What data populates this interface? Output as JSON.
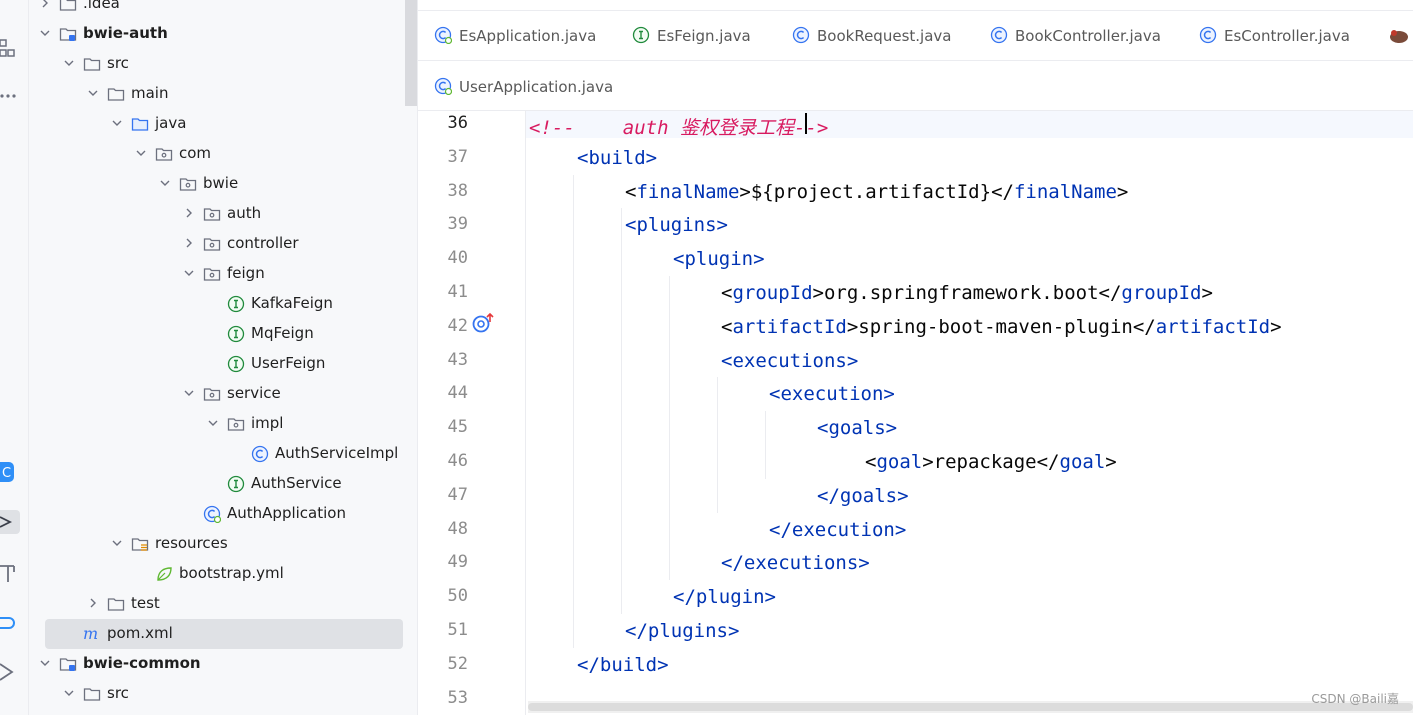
{
  "tree": {
    "rows": [
      {
        "label": ".idea",
        "icon": "folder-icon",
        "bold": false
      },
      {
        "label": "bwie-auth",
        "icon": "module-folder-icon",
        "bold": true
      },
      {
        "label": "src",
        "icon": "folder-icon",
        "bold": false
      },
      {
        "label": "main",
        "icon": "folder-icon",
        "bold": false
      },
      {
        "label": "java",
        "icon": "source-folder-icon",
        "bold": false
      },
      {
        "label": "com",
        "icon": "package-icon",
        "bold": false
      },
      {
        "label": "bwie",
        "icon": "package-icon",
        "bold": false
      },
      {
        "label": "auth",
        "icon": "package-icon",
        "bold": false
      },
      {
        "label": "controller",
        "icon": "package-icon",
        "bold": false
      },
      {
        "label": "feign",
        "icon": "package-icon",
        "bold": false
      },
      {
        "label": "KafkaFeign",
        "icon": "interface-icon",
        "bold": false
      },
      {
        "label": "MqFeign",
        "icon": "interface-icon",
        "bold": false
      },
      {
        "label": "UserFeign",
        "icon": "interface-icon",
        "bold": false
      },
      {
        "label": "service",
        "icon": "package-icon",
        "bold": false
      },
      {
        "label": "impl",
        "icon": "package-icon",
        "bold": false
      },
      {
        "label": "AuthServiceImpl",
        "icon": "class-icon",
        "bold": false
      },
      {
        "label": "AuthService",
        "icon": "interface-icon",
        "bold": false
      },
      {
        "label": "AuthApplication",
        "icon": "spring-boot-class-icon",
        "bold": false
      },
      {
        "label": "resources",
        "icon": "resources-folder-icon",
        "bold": false
      },
      {
        "label": "bootstrap.yml",
        "icon": "yaml-leaf-icon",
        "bold": false
      },
      {
        "label": "test",
        "icon": "folder-icon",
        "bold": false
      },
      {
        "label": "pom.xml",
        "icon": "maven-icon",
        "bold": false,
        "selected": true
      },
      {
        "label": "bwie-common",
        "icon": "module-folder-icon",
        "bold": true
      },
      {
        "label": "src",
        "icon": "folder-icon",
        "bold": false
      }
    ]
  },
  "tabs": [
    {
      "label": "EsApplication.java",
      "icon": "spring-boot-class-icon"
    },
    {
      "label": "EsFeign.java",
      "icon": "interface-icon"
    },
    {
      "label": "BookRequest.java",
      "icon": "class-icon"
    },
    {
      "label": "BookController.java",
      "icon": "class-icon"
    },
    {
      "label": "EsController.java",
      "icon": "class-icon"
    },
    {
      "label": "UserApplication.java",
      "icon": "spring-boot-class-icon"
    }
  ],
  "editor": {
    "line_numbers": [
      "36",
      "37",
      "38",
      "39",
      "40",
      "41",
      "42",
      "43",
      "44",
      "45",
      "46",
      "47",
      "48",
      "49",
      "50",
      "51",
      "52",
      "53"
    ],
    "current_line": "36",
    "comment": {
      "open": "<!--",
      "text": "auth 鉴权登录工程",
      "close": "-->"
    },
    "lines": [
      {
        "t1": "<build>"
      },
      {
        "t1": "<",
        "t2": "finalName",
        "t3": ">${project.artifactId}</",
        "t4": "finalName",
        "t5": ">"
      },
      {
        "t1": "<plugins>"
      },
      {
        "t1": "<plugin>"
      },
      {
        "t1": "<",
        "t2": "groupId",
        "t3": ">org.springframework.boot</",
        "t4": "groupId",
        "t5": ">"
      },
      {
        "t1": "<",
        "t2": "artifactId",
        "t3": ">spring-boot-maven-plugin</",
        "t4": "artifactId",
        "t5": ">"
      },
      {
        "t1": "<executions>"
      },
      {
        "t1": "<execution>"
      },
      {
        "t1": "<goals>"
      },
      {
        "t1": "<",
        "t2": "goal",
        "t3": ">repackage</",
        "t4": "goal",
        "t5": ">"
      },
      {
        "t1": "</goals>"
      },
      {
        "t1": "</execution>"
      },
      {
        "t1": "</executions>"
      },
      {
        "t1": "</plugin>"
      },
      {
        "t1": "</plugins>"
      },
      {
        "t1": "</build>"
      }
    ]
  },
  "watermark": "CSDN @Baili嘉",
  "colors": {
    "tag": "#0033b3",
    "comment": "#d81b60",
    "selection": "#dfe1e5"
  }
}
